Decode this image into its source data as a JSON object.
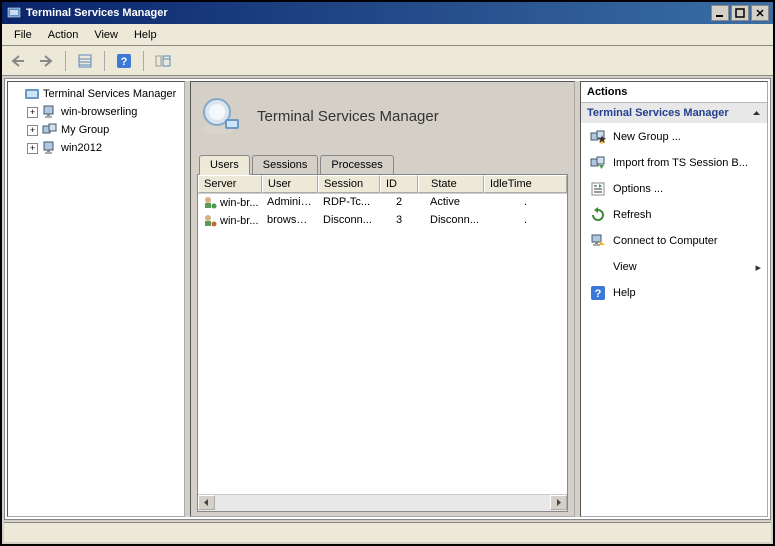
{
  "window": {
    "title": "Terminal Services Manager"
  },
  "menu": {
    "file": "File",
    "action": "Action",
    "view": "View",
    "help": "Help"
  },
  "tree": {
    "root": "Terminal Services Manager",
    "items": [
      {
        "label": "win-browserling"
      },
      {
        "label": "My Group"
      },
      {
        "label": "win2012"
      }
    ]
  },
  "mid": {
    "title": "Terminal Services Manager",
    "tabs": {
      "users": "Users",
      "sessions": "Sessions",
      "processes": "Processes"
    },
    "columns": {
      "server": "Server",
      "user": "User",
      "session": "Session",
      "id": "ID",
      "state": "State",
      "idle": "IdleTime"
    },
    "rows": [
      {
        "server": "win-br...",
        "user": "Administ...",
        "session": "RDP-Tc...",
        "id": "2",
        "state": "Active",
        "idle": "."
      },
      {
        "server": "win-br...",
        "user": "browserl...",
        "session": "Disconn...",
        "id": "3",
        "state": "Disconn...",
        "idle": "."
      }
    ]
  },
  "actions": {
    "title": "Actions",
    "subtitle": "Terminal Services Manager",
    "items": {
      "new_group": "New Group ...",
      "import": "Import from TS Session B...",
      "options": "Options ...",
      "refresh": "Refresh",
      "connect": "Connect to Computer",
      "view": "View",
      "help": "Help"
    }
  }
}
